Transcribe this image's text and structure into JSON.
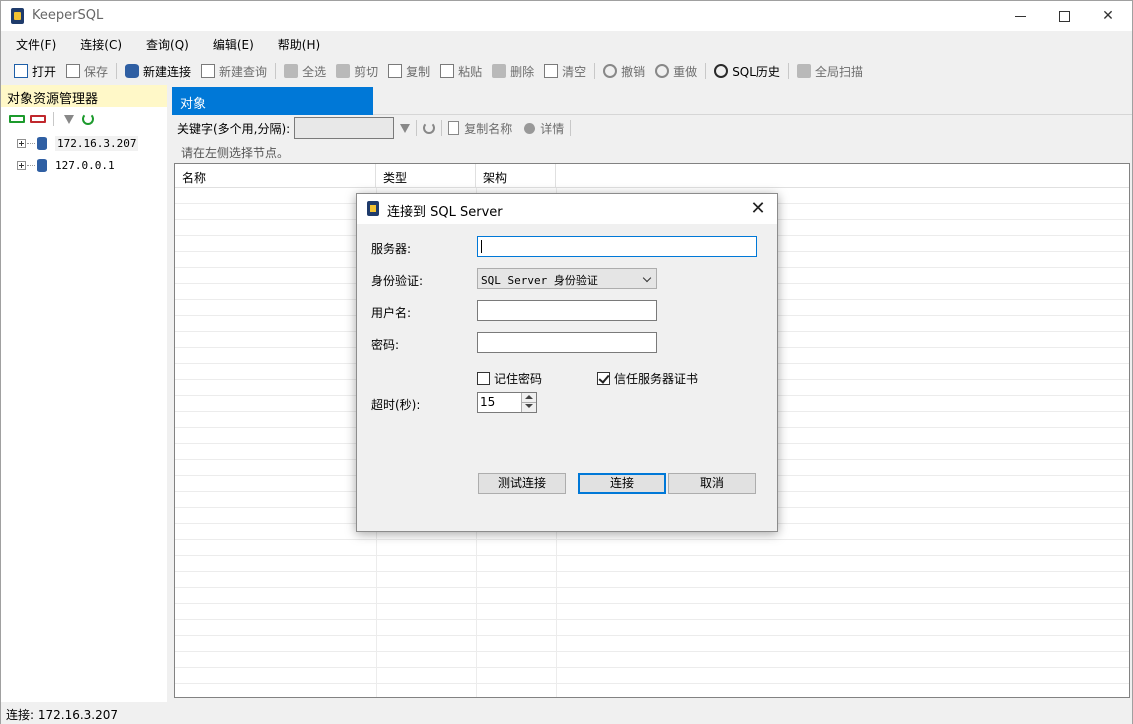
{
  "app": {
    "title": "KeeperSQL"
  },
  "menu": [
    "文件(F)",
    "连接(C)",
    "查询(Q)",
    "编辑(E)",
    "帮助(H)"
  ],
  "toolbar": {
    "open": "打开",
    "save": "保存",
    "new_connection": "新建连接",
    "new_query": "新建查询",
    "select_all": "全选",
    "cut": "剪切",
    "copy": "复制",
    "paste": "粘贴",
    "delete": "删除",
    "clear": "清空",
    "undo": "撤销",
    "redo": "重做",
    "sql_history": "SQL历史",
    "global_scan": "全局扫描"
  },
  "explorer": {
    "title": "对象资源管理器",
    "nodes": [
      "172.16.3.207",
      "127.0.0.1"
    ]
  },
  "objects": {
    "tab": "对象",
    "keyword_label": "关键字(多个用,分隔):",
    "keyword_value": "",
    "copy_name": "复制名称",
    "details": "详情",
    "hint": "请在左侧选择节点。",
    "columns": [
      "名称",
      "类型",
      "架构"
    ]
  },
  "status": {
    "text": "连接: 172.16.3.207"
  },
  "dialog": {
    "title": "连接到 SQL Server",
    "server_label": "服务器:",
    "server_value": "",
    "auth_label": "身份验证:",
    "auth_value": "SQL Server 身份验证",
    "username_label": "用户名:",
    "username_value": "",
    "password_label": "密码:",
    "password_value": "",
    "remember_password": "记住密码",
    "remember_checked": false,
    "trust_cert": "信任服务器证书",
    "trust_checked": true,
    "timeout_label": "超时(秒):",
    "timeout_value": "15",
    "test_button": "测试连接",
    "connect_button": "连接",
    "cancel_button": "取消"
  }
}
